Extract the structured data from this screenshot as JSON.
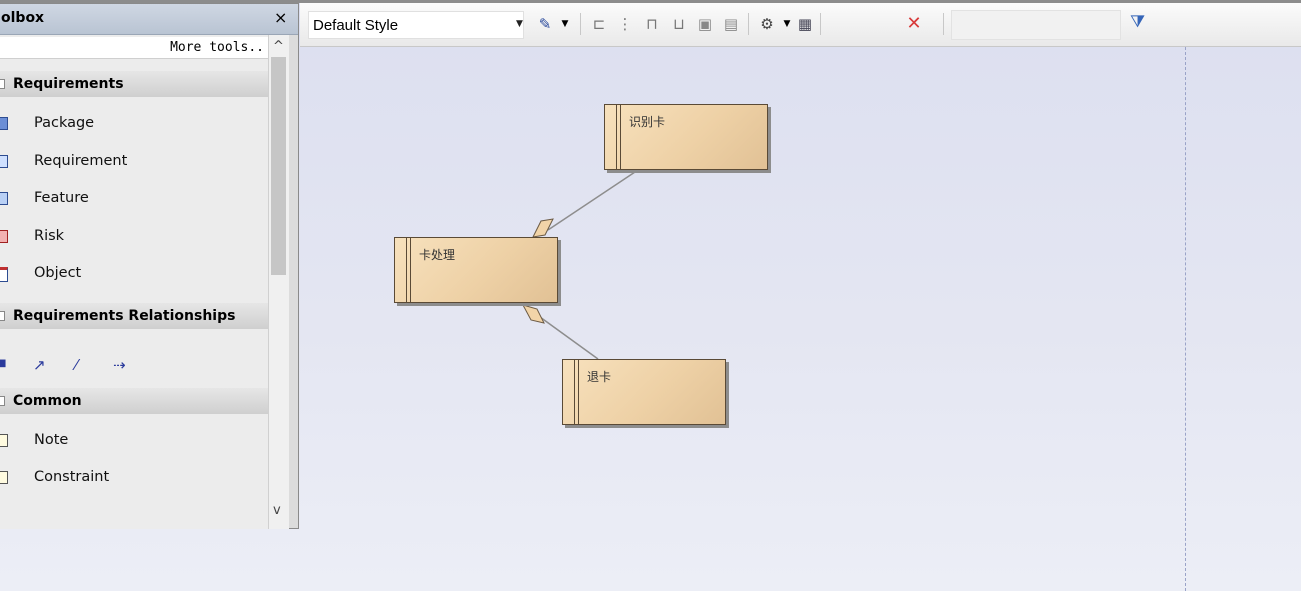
{
  "toolbox": {
    "title": "olbox",
    "close_glyph": "×",
    "more_tools": "More tools..",
    "groups": {
      "requirements": {
        "label": "Requirements",
        "items": [
          {
            "label": "Package",
            "icon": "package-icon"
          },
          {
            "label": "Requirement",
            "icon": "requirement-icon"
          },
          {
            "label": "Feature",
            "icon": "feature-icon"
          },
          {
            "label": "Risk",
            "icon": "risk-icon"
          },
          {
            "label": "Object",
            "icon": "object-icon"
          }
        ]
      },
      "relationships": {
        "label": "Requirements Relationships",
        "icons": [
          "dependency-icon",
          "realization-icon",
          "association-icon",
          "trace-icon"
        ]
      },
      "common": {
        "label": "Common",
        "items": [
          {
            "label": "Note",
            "icon": "note-icon"
          },
          {
            "label": "Constraint",
            "icon": "constraint-icon"
          }
        ]
      }
    },
    "scroll_up": "^",
    "scroll_down": "v"
  },
  "toolbar": {
    "style_select_value": "Default Style",
    "dropdown_glyph": "▾",
    "icons": [
      "format-painter-icon",
      "align-left-icon",
      "align-center-icon",
      "align-top-icon",
      "align-bottom-icon",
      "same-size-icon",
      "bring-front-icon",
      "layout-icon",
      "properties-icon",
      "delete-icon",
      "filter-icon"
    ],
    "delete_glyph": "✕",
    "filter_glyph": "⧩"
  },
  "diagram": {
    "elements": [
      {
        "id": "e1",
        "label": "识别卡"
      },
      {
        "id": "e2",
        "label": "卡处理"
      },
      {
        "id": "e3",
        "label": "退卡"
      }
    ]
  },
  "colors": {
    "element_fill": "#f3dab4",
    "element_border": "#5a4a36",
    "canvas_bg": "#e1e3f0",
    "delete_red": "#d83a3a",
    "filter_blue": "#3565b8"
  }
}
